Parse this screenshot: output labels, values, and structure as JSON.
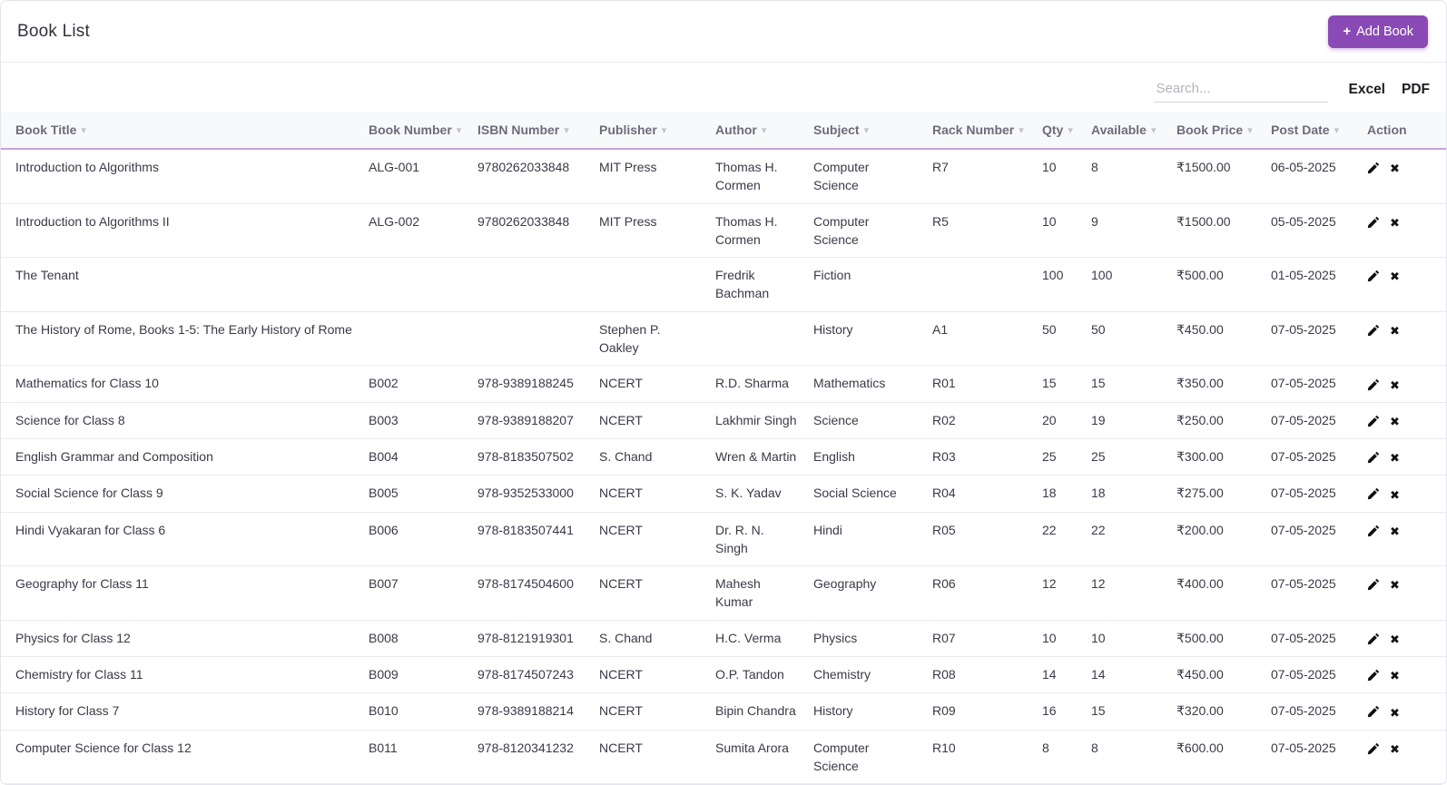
{
  "header": {
    "title": "Book List",
    "add_book": {
      "icon": "+",
      "label": "Add Book"
    }
  },
  "toolbar": {
    "search_placeholder": "Search...",
    "excel_label": "Excel",
    "pdf_label": "PDF"
  },
  "colors": {
    "accent_purple": "#8a4ab5",
    "header_underline_purple": "#c8a2dc",
    "header_bg": "#f8f9fa"
  },
  "table": {
    "columns": [
      {
        "key": "title",
        "label": "Book Title",
        "sortable": true
      },
      {
        "key": "book_number",
        "label": "Book Number",
        "sortable": true
      },
      {
        "key": "isbn",
        "label": "ISBN Number",
        "sortable": true
      },
      {
        "key": "publisher",
        "label": "Publisher",
        "sortable": true
      },
      {
        "key": "author",
        "label": "Author",
        "sortable": true
      },
      {
        "key": "subject",
        "label": "Subject",
        "sortable": true
      },
      {
        "key": "rack",
        "label": "Rack Number",
        "sortable": true
      },
      {
        "key": "qty",
        "label": "Qty",
        "sortable": true
      },
      {
        "key": "available",
        "label": "Available",
        "sortable": true
      },
      {
        "key": "price",
        "label": "Book Price",
        "sortable": true
      },
      {
        "key": "post_date",
        "label": "Post Date",
        "sortable": true
      },
      {
        "key": "action",
        "label": "Action",
        "sortable": false
      }
    ],
    "rows": [
      {
        "title": "Introduction to Algorithms",
        "book_number": "ALG-001",
        "isbn": "9780262033848",
        "publisher": "MIT Press",
        "author": "Thomas H. Cormen",
        "subject": "Computer Science",
        "rack": "R7",
        "qty": "10",
        "available": "8",
        "price": "₹1500.00",
        "post_date": "06-05-2025"
      },
      {
        "title": "Introduction to Algorithms II",
        "book_number": "ALG-002",
        "isbn": "9780262033848",
        "publisher": "MIT Press",
        "author": "Thomas H. Cormen",
        "subject": "Computer Science",
        "rack": "R5",
        "qty": "10",
        "available": "9",
        "price": "₹1500.00",
        "post_date": "05-05-2025"
      },
      {
        "title": "The Tenant",
        "book_number": "",
        "isbn": "",
        "publisher": "",
        "author": "Fredrik Bachman",
        "subject": "Fiction",
        "rack": "",
        "qty": "100",
        "available": "100",
        "price": "₹500.00",
        "post_date": "01-05-2025"
      },
      {
        "title": "The History of Rome, Books 1-5: The Early History of Rome",
        "book_number": "",
        "isbn": "",
        "publisher": "Stephen P. Oakley",
        "author": "",
        "subject": "History",
        "rack": "A1",
        "qty": "50",
        "available": "50",
        "price": "₹450.00",
        "post_date": "07-05-2025"
      },
      {
        "title": "Mathematics for Class 10",
        "book_number": "B002",
        "isbn": "978-9389188245",
        "publisher": "NCERT",
        "author": "R.D. Sharma",
        "subject": "Mathematics",
        "rack": "R01",
        "qty": "15",
        "available": "15",
        "price": "₹350.00",
        "post_date": "07-05-2025"
      },
      {
        "title": "Science for Class 8",
        "book_number": "B003",
        "isbn": "978-9389188207",
        "publisher": "NCERT",
        "author": "Lakhmir Singh",
        "subject": "Science",
        "rack": "R02",
        "qty": "20",
        "available": "19",
        "price": "₹250.00",
        "post_date": "07-05-2025"
      },
      {
        "title": "English Grammar and Composition",
        "book_number": "B004",
        "isbn": "978-8183507502",
        "publisher": "S. Chand",
        "author": "Wren & Martin",
        "subject": "English",
        "rack": "R03",
        "qty": "25",
        "available": "25",
        "price": "₹300.00",
        "post_date": "07-05-2025"
      },
      {
        "title": "Social Science for Class 9",
        "book_number": "B005",
        "isbn": "978-9352533000",
        "publisher": "NCERT",
        "author": "S. K. Yadav",
        "subject": "Social Science",
        "rack": "R04",
        "qty": "18",
        "available": "18",
        "price": "₹275.00",
        "post_date": "07-05-2025"
      },
      {
        "title": "Hindi Vyakaran for Class 6",
        "book_number": "B006",
        "isbn": "978-8183507441",
        "publisher": "NCERT",
        "author": "Dr. R. N. Singh",
        "subject": "Hindi",
        "rack": "R05",
        "qty": "22",
        "available": "22",
        "price": "₹200.00",
        "post_date": "07-05-2025"
      },
      {
        "title": "Geography for Class 11",
        "book_number": "B007",
        "isbn": "978-8174504600",
        "publisher": "NCERT",
        "author": "Mahesh Kumar",
        "subject": "Geography",
        "rack": "R06",
        "qty": "12",
        "available": "12",
        "price": "₹400.00",
        "post_date": "07-05-2025"
      },
      {
        "title": "Physics for Class 12",
        "book_number": "B008",
        "isbn": "978-8121919301",
        "publisher": "S. Chand",
        "author": "H.C. Verma",
        "subject": "Physics",
        "rack": "R07",
        "qty": "10",
        "available": "10",
        "price": "₹500.00",
        "post_date": "07-05-2025"
      },
      {
        "title": "Chemistry for Class 11",
        "book_number": "B009",
        "isbn": "978-8174507243",
        "publisher": "NCERT",
        "author": "O.P. Tandon",
        "subject": "Chemistry",
        "rack": "R08",
        "qty": "14",
        "available": "14",
        "price": "₹450.00",
        "post_date": "07-05-2025"
      },
      {
        "title": "History for Class 7",
        "book_number": "B010",
        "isbn": "978-9389188214",
        "publisher": "NCERT",
        "author": "Bipin Chandra",
        "subject": "History",
        "rack": "R09",
        "qty": "16",
        "available": "15",
        "price": "₹320.00",
        "post_date": "07-05-2025"
      },
      {
        "title": "Computer Science for Class 12",
        "book_number": "B011",
        "isbn": "978-8120341232",
        "publisher": "NCERT",
        "author": "Sumita Arora",
        "subject": "Computer Science",
        "rack": "R10",
        "qty": "8",
        "available": "8",
        "price": "₹600.00",
        "post_date": "07-05-2025"
      }
    ]
  }
}
